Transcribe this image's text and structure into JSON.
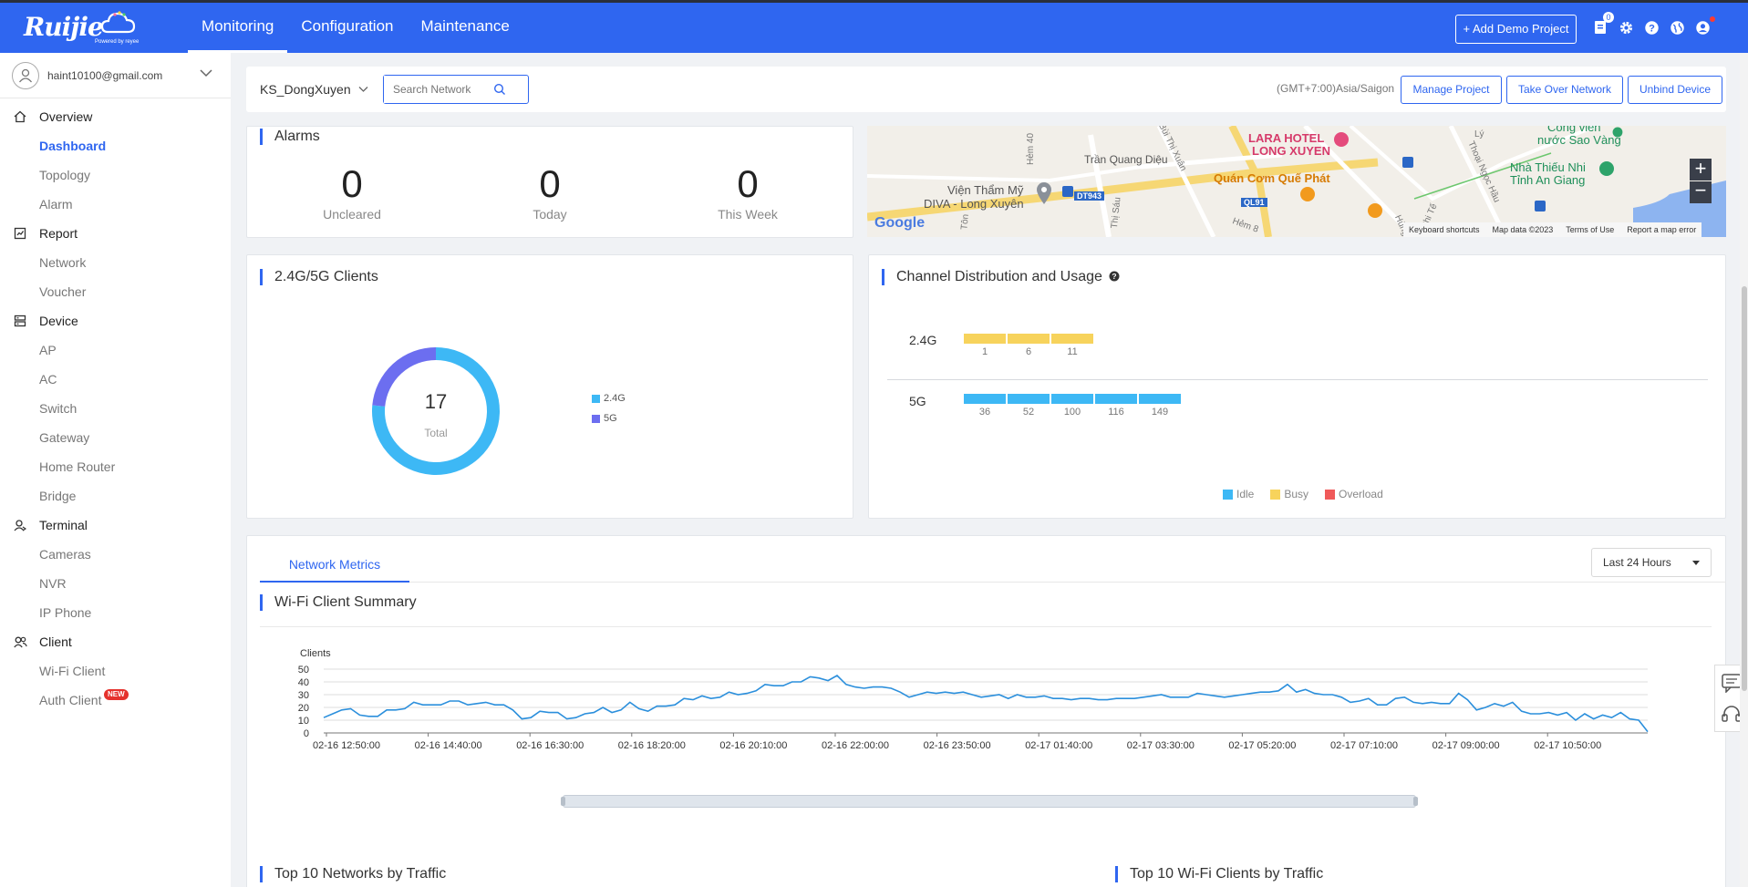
{
  "header": {
    "brand": "Ruijie",
    "brand_sub": "Powered by reyee",
    "nav": [
      "Monitoring",
      "Configuration",
      "Maintenance"
    ],
    "add_demo_label": "+ Add Demo Project",
    "notification_count": "0"
  },
  "sidebar": {
    "user_email": "haint10100@gmail.com",
    "groups": [
      {
        "label": "Overview",
        "icon": "home-icon",
        "items": [
          "Dashboard",
          "Topology",
          "Alarm"
        ]
      },
      {
        "label": "Report",
        "icon": "report-icon",
        "items": [
          "Network",
          "Voucher"
        ]
      },
      {
        "label": "Device",
        "icon": "device-icon",
        "items": [
          "AP",
          "AC",
          "Switch",
          "Gateway",
          "Home Router",
          "Bridge"
        ]
      },
      {
        "label": "Terminal",
        "icon": "terminal-icon",
        "items": [
          "Cameras",
          "NVR",
          "IP Phone"
        ]
      },
      {
        "label": "Client",
        "icon": "client-icon",
        "items": [
          "Wi-Fi Client",
          "Auth Client"
        ]
      }
    ],
    "active_item": "Dashboard",
    "new_badge": "NEW"
  },
  "filter": {
    "project": "KS_DongXuyen",
    "search_placeholder": "Search Network",
    "timezone": "(GMT+7:00)Asia/Saigon",
    "manage_label": "Manage Project",
    "takeover_label": "Take Over Network",
    "unbind_label": "Unbind Device"
  },
  "alarms": {
    "title": "Alarms",
    "stats": [
      {
        "value": "0",
        "label": "Uncleared"
      },
      {
        "value": "0",
        "label": "Today"
      },
      {
        "value": "0",
        "label": "This Week"
      }
    ]
  },
  "map": {
    "labels": [
      "LARA HOTEL",
      "LONG XUYEN",
      "Công viên",
      "nước Sao Vàng",
      "Trần Quang Diệu",
      "Viện Thẩm Mỹ",
      "DIVA - Long Xuyên",
      "Quán Cơm Quế Phát",
      "Nhà Thiếu Nhi",
      "Tỉnh An Giang",
      "Bùi Thị Xuân",
      "Hẻm 40",
      "Thoại Ngọc Hầu",
      "Lý",
      "Tôn",
      "Thị Sáu",
      "Hẻm 8",
      "Hùng",
      "Chi Tế"
    ],
    "road_labels": [
      "DT943",
      "QL91"
    ],
    "google": "Google",
    "footer": [
      "Keyboard shortcuts",
      "Map data ©2023",
      "Terms of Use",
      "Report a map error"
    ]
  },
  "clients": {
    "title": "2.4G/5G Clients",
    "total": "17",
    "total_label": "Total",
    "legend": [
      {
        "name": "2.4G",
        "color": "#3db8f5"
      },
      {
        "name": "5G",
        "color": "#6c6ef0"
      }
    ]
  },
  "clients_chart": {
    "type": "pie",
    "slices": [
      {
        "name": "2.4G",
        "value": 13
      },
      {
        "name": "5G",
        "value": 4
      }
    ]
  },
  "channels": {
    "title": "Channel Distribution and Usage",
    "band24": {
      "label": "2.4G",
      "channels": [
        "1",
        "6",
        "11"
      ]
    },
    "band5": {
      "label": "5G",
      "channels": [
        "36",
        "52",
        "100",
        "116",
        "149"
      ]
    },
    "legend": [
      {
        "name": "Idle",
        "color": "#3db8f5"
      },
      {
        "name": "Busy",
        "color": "#f7d35c"
      },
      {
        "name": "Overload",
        "color": "#f05a5a"
      }
    ],
    "usage_24": "Busy",
    "usage_5": "Idle"
  },
  "metrics": {
    "tab": "Network Metrics",
    "range": "Last 24 Hours",
    "section_title": "Wi-Fi Client Summary",
    "bottom_left_title": "Top 10 Networks by Traffic",
    "bottom_right_title": "Top 10 Wi-Fi Clients by Traffic"
  },
  "chart_data": {
    "type": "line",
    "ylabel": "Clients",
    "ylim": [
      0,
      50
    ],
    "yticks": [
      0,
      10,
      20,
      30,
      40,
      50
    ],
    "xticks": [
      "02-16 12:50:00",
      "02-16 14:40:00",
      "02-16 16:30:00",
      "02-16 18:20:00",
      "02-16 20:10:00",
      "02-16 22:00:00",
      "02-16 23:50:00",
      "02-17 01:40:00",
      "02-17 03:30:00",
      "02-17 05:20:00",
      "02-17 07:10:00",
      "02-17 09:00:00",
      "02-17 10:50:00"
    ],
    "series": [
      {
        "values": [
          12,
          15,
          18,
          19,
          14,
          13,
          13,
          18,
          18,
          19,
          24,
          22,
          22,
          22,
          25,
          25,
          22,
          23,
          24,
          22,
          22,
          18,
          11,
          12,
          17,
          16,
          16,
          11,
          12,
          15,
          16,
          20,
          16,
          18,
          24,
          19,
          17,
          21,
          21,
          22,
          27,
          26,
          29,
          27,
          28,
          32,
          30,
          31,
          33,
          38,
          37,
          37,
          40,
          40,
          44,
          43,
          41,
          45,
          38,
          36,
          35,
          36,
          36,
          35,
          32,
          28,
          30,
          32,
          31,
          32,
          31,
          32,
          30,
          28,
          29,
          30,
          27,
          30,
          28,
          28,
          29,
          27,
          27,
          26,
          27,
          27,
          26,
          26,
          27,
          27,
          27,
          28,
          29,
          30,
          28,
          28,
          28,
          31,
          30,
          29,
          28,
          29,
          30,
          31,
          32,
          32,
          33,
          38,
          32,
          34,
          31,
          30,
          30,
          28,
          24,
          25,
          27,
          22,
          22,
          27,
          28,
          24,
          23,
          24,
          23,
          23,
          31,
          26,
          18,
          20,
          23,
          21,
          24,
          17,
          15,
          15,
          16,
          14,
          16,
          10,
          15,
          11,
          14,
          12,
          16,
          11,
          10,
          1
        ]
      }
    ]
  }
}
